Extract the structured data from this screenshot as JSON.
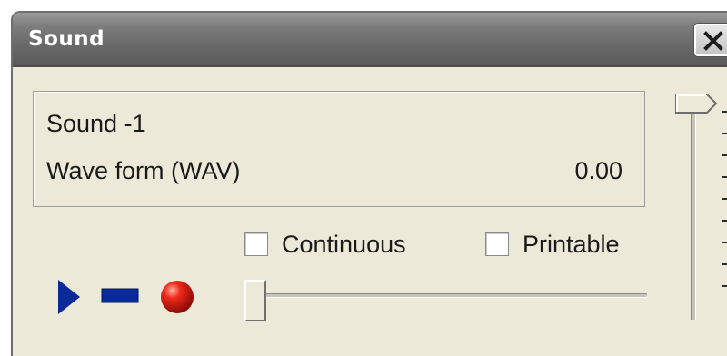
{
  "window": {
    "title": "Sound"
  },
  "info": {
    "name": "Sound -1",
    "format": "Wave form (WAV)",
    "duration": "0.00"
  },
  "options": {
    "continuous": {
      "label": "Continuous",
      "checked": false
    },
    "printable": {
      "label": "Printable",
      "checked": false
    }
  },
  "controls": {
    "play_icon": "play-icon",
    "stop_icon": "stop-icon",
    "record_icon": "record-icon",
    "play_color": "#0a2a9a",
    "stop_color": "#0a2a9a",
    "record_color": "#e01010"
  },
  "position_slider": {
    "value": 0
  },
  "volume_slider": {
    "value": 1
  }
}
